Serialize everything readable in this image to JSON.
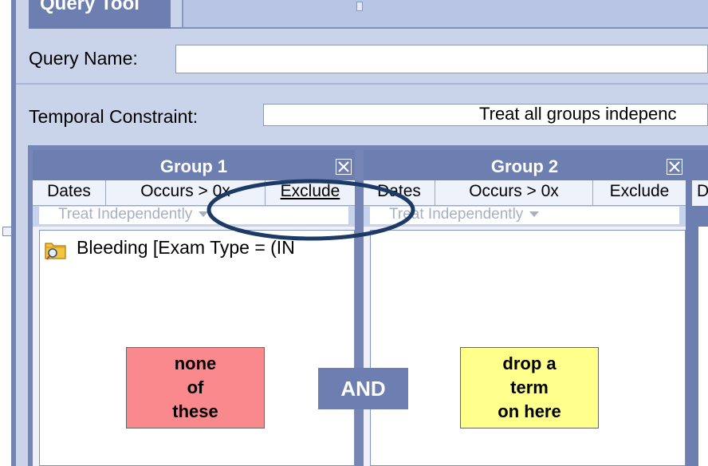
{
  "tab": {
    "title": "Query Tool"
  },
  "query_name": {
    "label": "Query Name:",
    "value": ""
  },
  "temporal": {
    "label": "Temporal Constraint:",
    "value": "Treat all groups indepenc"
  },
  "groups": [
    {
      "title": "Group 1",
      "buttons": {
        "dates": "Dates",
        "occurs": "Occurs > 0x",
        "exclude": "Exclude"
      },
      "timing": "Treat Independently",
      "term": "Bleeding [Exam Type = (IN",
      "note": "none\nof\nthese"
    },
    {
      "title": "Group 2",
      "buttons": {
        "dates": "Dates",
        "occurs": "Occurs > 0x",
        "exclude": "Exclude"
      },
      "timing": "Treat Independently",
      "note": "drop a\nterm\non here"
    }
  ],
  "and_label": "AND",
  "group3_partial": {
    "dates_stub": "D"
  },
  "colors": {
    "panel_bg": "#c9d3ea",
    "header_blue": "#6d7eb0",
    "none_note": "#f9898c",
    "drop_note": "#ffff8b",
    "ellipse": "#1c3a66"
  },
  "icons": {
    "term": "folder-query-icon",
    "close": "close-x-icon",
    "dropdown": "dropdown-arrow-icon"
  }
}
